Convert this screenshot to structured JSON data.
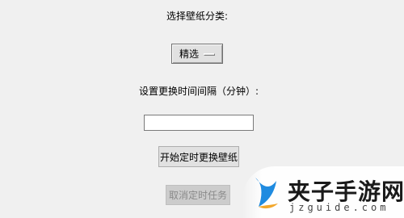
{
  "wallpaper_label": "选择壁纸分类:",
  "category": {
    "selected": "精选"
  },
  "interval_label": "设置更换时间间隔（分钟）:",
  "interval_input": {
    "value": "",
    "placeholder": ""
  },
  "start_button_label": "开始定时更换壁纸",
  "cancel_button_label": "取消定时任务",
  "watermark": {
    "title": "夹子手游网",
    "url": "jzguide.com"
  },
  "colors": {
    "window_bg": "#f0f0f0",
    "button_bg": "#e1e1e1",
    "disabled_text": "#8a8a8a",
    "logo_blue": "#1f8be0"
  }
}
